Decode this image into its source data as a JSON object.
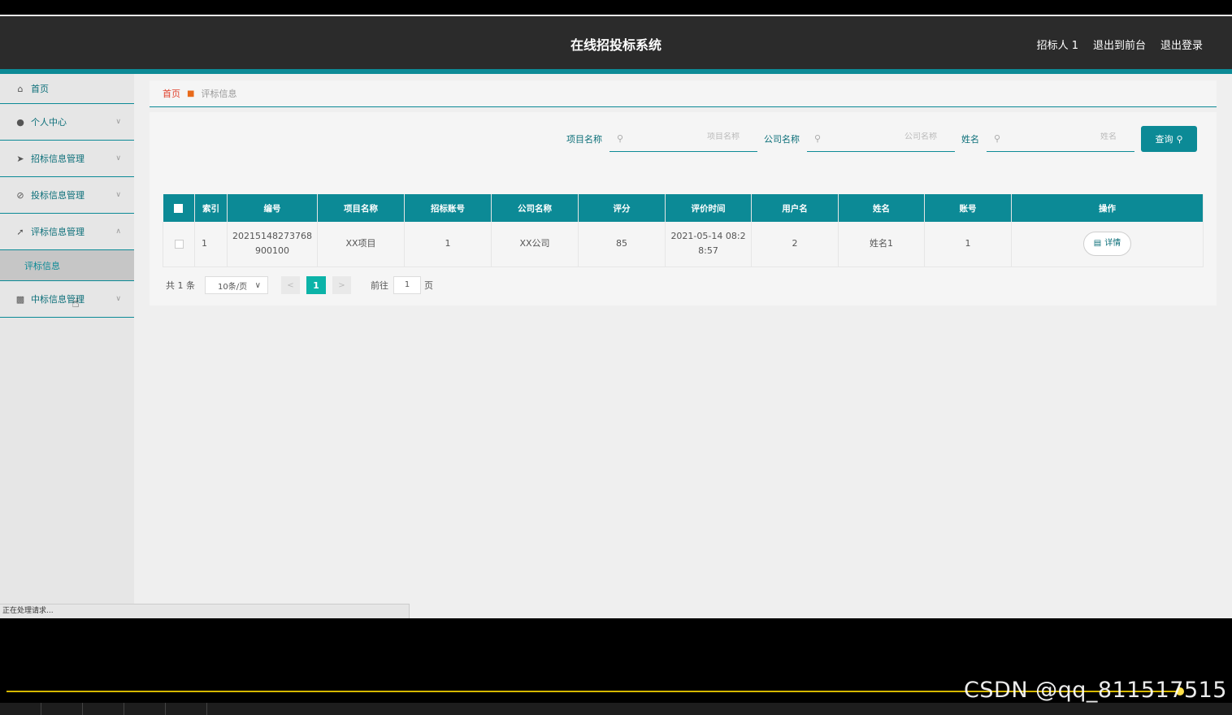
{
  "header": {
    "title": "在线招投标系统",
    "links": [
      "招标人 1",
      "退出到前台",
      "退出登录"
    ]
  },
  "sidebar": {
    "items": [
      {
        "label": "首页",
        "icon": "home-icon"
      },
      {
        "label": "个人中心",
        "icon": "user-icon"
      },
      {
        "label": "招标信息管理",
        "icon": "send-icon"
      },
      {
        "label": "投标信息管理",
        "icon": "bell-off-icon"
      },
      {
        "label": "评标信息管理",
        "icon": "navigation-icon"
      },
      {
        "label": "中标信息管理",
        "icon": "briefcase-icon"
      }
    ],
    "active_sub": "评标信息"
  },
  "breadcrumb": {
    "home": "首页",
    "current": "评标信息"
  },
  "search": {
    "project_label": "项目名称",
    "project_placeholder": "项目名称",
    "company_label": "公司名称",
    "company_placeholder": "公司名称",
    "name_label": "姓名",
    "name_placeholder": "姓名",
    "button": "查询"
  },
  "table": {
    "headers": [
      "索引",
      "编号",
      "项目名称",
      "招标账号",
      "公司名称",
      "评分",
      "评价时间",
      "用户名",
      "姓名",
      "账号",
      "操作"
    ],
    "rows": [
      {
        "index": "1",
        "code_line1": "20215148273768",
        "code_line2": "900100",
        "project": "XX项目",
        "tender_account": "1",
        "company": "XX公司",
        "score": "85",
        "time_line1": "2021-05-14 08:2",
        "time_line2": "8:57",
        "username": "2",
        "name": "姓名1",
        "account": "1",
        "action": "详情"
      }
    ]
  },
  "pager": {
    "total": "共 1 条",
    "page_size": "10条/页",
    "current_page": "1",
    "goto_label": "前往",
    "goto_value": "1",
    "page_suffix": "页"
  },
  "status_bar": "正在处理请求...",
  "watermark": "CSDN @qq_811517515",
  "colors": {
    "accent": "#0c8a96",
    "header_bg": "#2b2b2b",
    "page_active": "#0cb3a8"
  }
}
